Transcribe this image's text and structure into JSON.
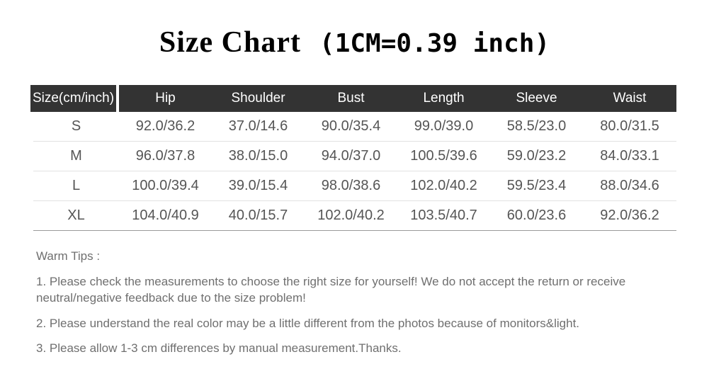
{
  "title": {
    "main": "Size Chart",
    "conversion": "(1CM=0.39 inch)"
  },
  "table": {
    "headers": [
      "Size(cm/inch)",
      "Hip",
      "Shoulder",
      "Bust",
      "Length",
      "Sleeve",
      "Waist"
    ],
    "rows": [
      {
        "size": "S",
        "hip": "92.0/36.2",
        "shoulder": "37.0/14.6",
        "bust": "90.0/35.4",
        "length": "99.0/39.0",
        "sleeve": "58.5/23.0",
        "waist": "80.0/31.5"
      },
      {
        "size": "M",
        "hip": "96.0/37.8",
        "shoulder": "38.0/15.0",
        "bust": "94.0/37.0",
        "length": "100.5/39.6",
        "sleeve": "59.0/23.2",
        "waist": "84.0/33.1"
      },
      {
        "size": "L",
        "hip": "100.0/39.4",
        "shoulder": "39.0/15.4",
        "bust": "98.0/38.6",
        "length": "102.0/40.2",
        "sleeve": "59.5/23.4",
        "waist": "88.0/34.6"
      },
      {
        "size": "XL",
        "hip": "104.0/40.9",
        "shoulder": "40.0/15.7",
        "bust": "102.0/40.2",
        "length": "103.5/40.7",
        "sleeve": "60.0/23.6",
        "waist": "92.0/36.2"
      }
    ]
  },
  "tips": {
    "heading": "Warm Tips :",
    "items": [
      "1. Please check the measurements to choose the right size for yourself! We do not accept the return or receive neutral/negative feedback due to the size problem!",
      "2. Please understand the real color may be a little different from the photos because of monitors&light.",
      "3. Please allow 1-3 cm differences by manual measurement.Thanks."
    ]
  },
  "colors": {
    "header_background": "#333333",
    "header_text": "#ffffff",
    "cell_text": "#555555",
    "tips_text": "#6f6f6f",
    "row_divider": "#e2e2e2",
    "table_bottom_border": "#9a9a9a",
    "title_text": "#000000",
    "page_background": "#ffffff"
  }
}
